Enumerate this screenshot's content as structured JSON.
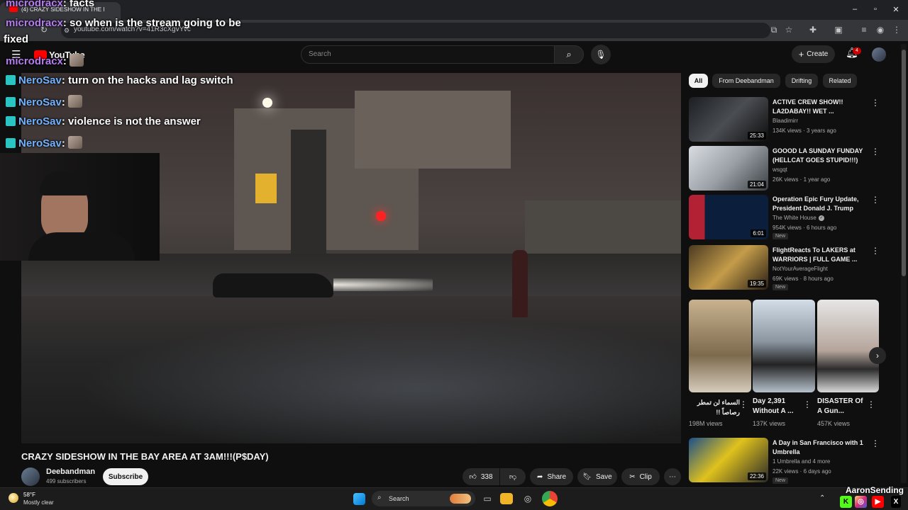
{
  "browser": {
    "tab_title": "(4) CRAZY SIDESHOW IN THE I",
    "url": "youtube.com/watch?v=41R3cXgvYvc"
  },
  "youtube": {
    "logo_text": "YouTube",
    "search_placeholder": "Search",
    "create_label": "Create",
    "notification_count": "4"
  },
  "chat": [
    {
      "user": "microdracx",
      "message": ": facts"
    },
    {
      "user": "microdracx",
      "message": ": so when is the stream going to be"
    },
    {
      "user": "",
      "message": "fixed"
    },
    {
      "user": "microdracx",
      "message": ":"
    },
    {
      "user": "NeroSav",
      "message": ": turn on the hacks and lag switch"
    },
    {
      "user": "NeroSav",
      "message": ":"
    },
    {
      "user": "NeroSav",
      "message": ": violence is not the answer"
    },
    {
      "user": "NeroSav",
      "message": ":"
    }
  ],
  "video": {
    "title": "CRAZY SIDESHOW IN THE BAY AREA AT 3AM!!!(P$DAY)",
    "channel": "Deebandman",
    "subscribers": "499 subscribers",
    "subscribe_label": "Subscribe",
    "likes": "338",
    "share_label": "Share",
    "save_label": "Save",
    "clip_label": "Clip"
  },
  "chips": [
    "All",
    "From Deebandman",
    "Drifting",
    "Related"
  ],
  "recommendations": [
    {
      "title": "ACTIVE CREW SHOW!! LA2DABAY!! WET ...",
      "channel": "Blaadimirr",
      "meta": "134K views · 3 years ago",
      "duration": "25:33",
      "new": ""
    },
    {
      "title": "GOOOD LA SUNDAY FUNDAY (HELLCAT GOES STUPID!!!)",
      "channel": "wsgqt",
      "meta": "26K views · 1 year ago",
      "duration": "21:04",
      "new": ""
    },
    {
      "title": "Operation Epic Fury Update, President Donald J. Trump",
      "channel": "The White House",
      "meta": "954K views · 6 hours ago",
      "duration": "6:01",
      "new": "New"
    },
    {
      "title": "FlightReacts To LAKERS at WARRIORS | FULL GAME ...",
      "channel": "NotYourAverageFlight",
      "meta": "69K views · 8 hours ago",
      "duration": "19:35",
      "new": "New"
    }
  ],
  "shorts": [
    {
      "title": "السماء لن تمطر رصاصاً !!",
      "views": "198M views"
    },
    {
      "title": "Day 2,391 Without A ...",
      "views": "137K views"
    },
    {
      "title": "DISASTER Of A Gun...",
      "views": "457K views"
    }
  ],
  "recommendation_last": {
    "title": "A Day in San Francisco with 1 Umbrella",
    "channel": "1 Umbrella and 4 more",
    "meta": "22K views · 6 days ago",
    "duration": "22:36",
    "new": "New"
  },
  "taskbar": {
    "temperature": "58°F",
    "condition": "Mostly clear",
    "search_label": "Search"
  },
  "watermark": "AaronSending",
  "colors": {
    "background": "#0f0f0f",
    "youtube_red": "#ff0000",
    "chat_user": "#b57cf2",
    "chat_user_alt": "#72b3ff",
    "notification_badge": "#cc0000"
  }
}
